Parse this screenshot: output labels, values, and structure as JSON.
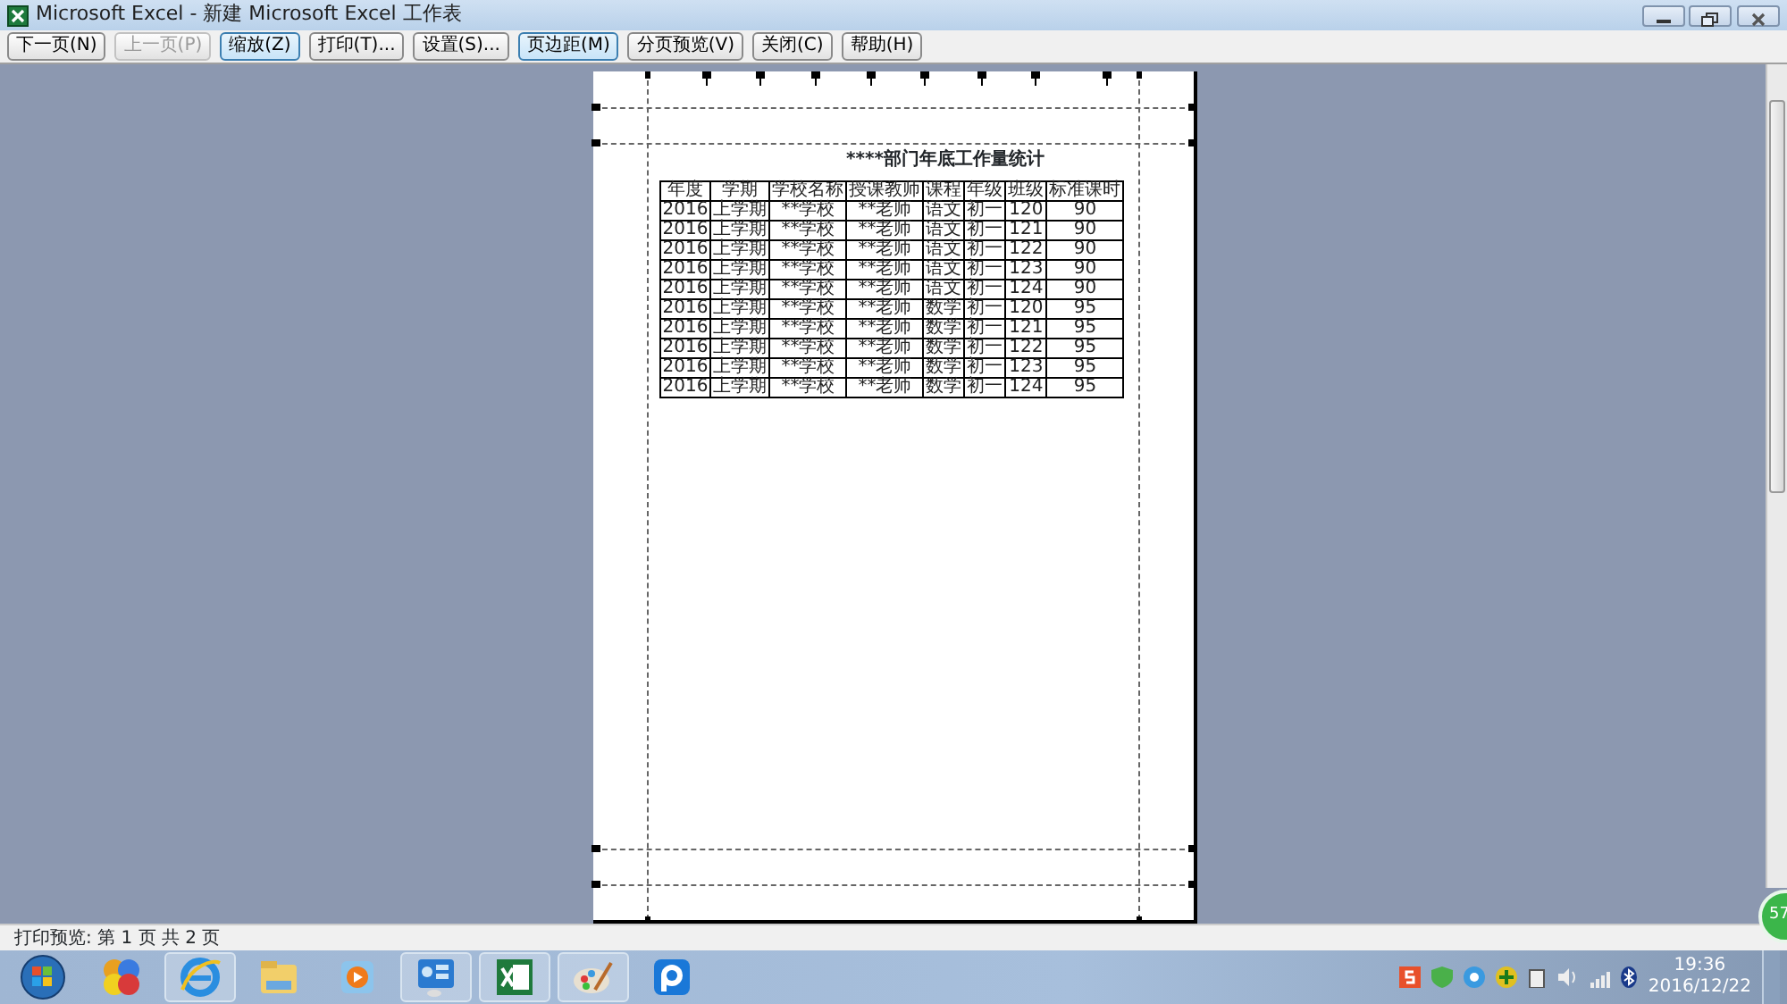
{
  "window": {
    "title": "Microsoft Excel - 新建 Microsoft Excel 工作表"
  },
  "toolbar": [
    {
      "label": "下一页(N)",
      "disabled": false,
      "pressed": false
    },
    {
      "label": "上一页(P)",
      "disabled": true,
      "pressed": false
    },
    {
      "label": "缩放(Z)",
      "disabled": false,
      "pressed": true
    },
    {
      "label": "打印(T)...",
      "disabled": false,
      "pressed": false
    },
    {
      "label": "设置(S)...",
      "disabled": false,
      "pressed": false
    },
    {
      "label": "页边距(M)",
      "disabled": false,
      "pressed": true
    },
    {
      "label": "分页预览(V)",
      "disabled": false,
      "pressed": false
    },
    {
      "label": "关闭(C)",
      "disabled": false,
      "pressed": false
    },
    {
      "label": "帮助(H)",
      "disabled": false,
      "pressed": false
    }
  ],
  "page": {
    "title": "****部门年底工作量统计",
    "table": {
      "columns": [
        "年度",
        "学期",
        "学校名称",
        "授课教师",
        "课程",
        "年级",
        "班级",
        "标准课时"
      ],
      "rows": [
        [
          "2016",
          "上学期",
          "**学校",
          "**老师",
          "语文",
          "初一",
          "120",
          "90"
        ],
        [
          "2016",
          "上学期",
          "**学校",
          "**老师",
          "语文",
          "初一",
          "121",
          "90"
        ],
        [
          "2016",
          "上学期",
          "**学校",
          "**老师",
          "语文",
          "初一",
          "122",
          "90"
        ],
        [
          "2016",
          "上学期",
          "**学校",
          "**老师",
          "语文",
          "初一",
          "123",
          "90"
        ],
        [
          "2016",
          "上学期",
          "**学校",
          "**老师",
          "语文",
          "初一",
          "124",
          "90"
        ],
        [
          "2016",
          "上学期",
          "**学校",
          "**老师",
          "数学",
          "初一",
          "120",
          "95"
        ],
        [
          "2016",
          "上学期",
          "**学校",
          "**老师",
          "数学",
          "初一",
          "121",
          "95"
        ],
        [
          "2016",
          "上学期",
          "**学校",
          "**老师",
          "数学",
          "初一",
          "122",
          "95"
        ],
        [
          "2016",
          "上学期",
          "**学校",
          "**老师",
          "数学",
          "初一",
          "123",
          "95"
        ],
        [
          "2016",
          "上学期",
          "**学校",
          "**老师",
          "数学",
          "初一",
          "124",
          "95"
        ]
      ]
    }
  },
  "status_bar": "打印预览: 第 1 页  共 2 页",
  "taskbar": {
    "apps": [
      {
        "kind": "start",
        "running": false
      },
      {
        "kind": "colorball",
        "running": false
      },
      {
        "kind": "browser",
        "running": true
      },
      {
        "kind": "folder",
        "running": false
      },
      {
        "kind": "media",
        "running": false
      },
      {
        "kind": "control",
        "running": true
      },
      {
        "kind": "excel",
        "running": true
      },
      {
        "kind": "paint",
        "running": true
      },
      {
        "kind": "pp",
        "running": false
      }
    ],
    "time": "19:36",
    "date": "2016/12/22"
  },
  "speed_ball": "57"
}
